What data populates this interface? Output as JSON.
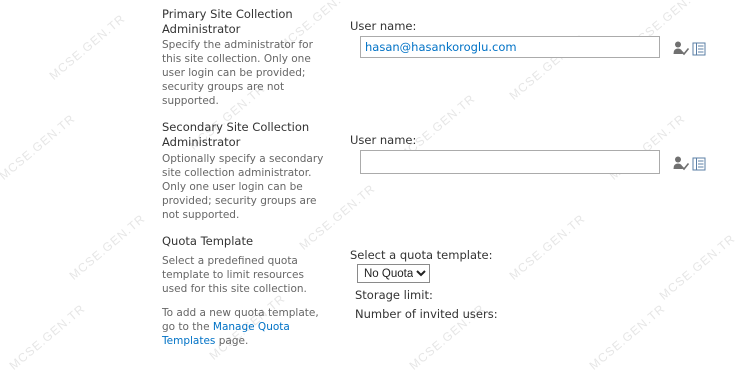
{
  "watermark": "MCSE.GEN.TR",
  "primary_admin": {
    "title": "Primary Site Collection Administrator",
    "description": "Specify the administrator for this site collection. Only one user login can be provided; security groups are not supported.",
    "username_label": "User name:",
    "username_value": "hasan@hasankoroglu.com",
    "check_names_icon": "check-names-icon",
    "browse_icon": "address-book-icon"
  },
  "secondary_admin": {
    "title": "Secondary Site Collection Administrator",
    "description": "Optionally specify a secondary site collection administrator. Only one user login can be provided; security groups are not supported.",
    "username_label": "User name:",
    "username_value": "",
    "check_names_icon": "check-names-icon",
    "browse_icon": "address-book-icon"
  },
  "quota": {
    "title": "Quota Template",
    "description": "Select a predefined quota template to limit resources used for this site collection.",
    "add_note_prefix": "To add a new quota template, go to the",
    "add_note_link": "Manage Quota Templates",
    "add_note_suffix": "page.",
    "select_label": "Select a quota template:",
    "selected_option": "No Quota",
    "storage_limit_label": "Storage limit:",
    "invited_users_label": "Number of invited users:"
  },
  "colors": {
    "link": "#0072c6",
    "input_border": "#ababab",
    "description_text": "#666666"
  }
}
